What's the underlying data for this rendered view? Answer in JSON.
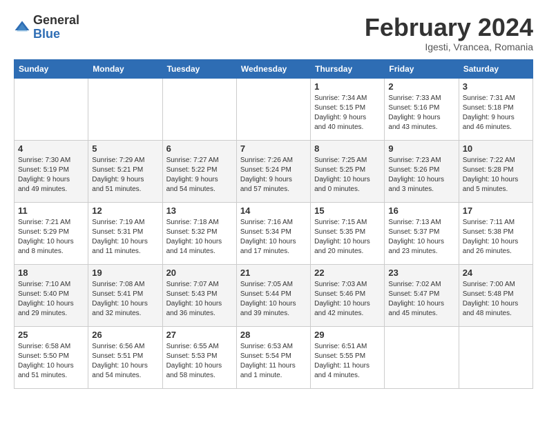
{
  "header": {
    "logo_general": "General",
    "logo_blue": "Blue",
    "title": "February 2024",
    "subtitle": "Igesti, Vrancea, Romania"
  },
  "days_of_week": [
    "Sunday",
    "Monday",
    "Tuesday",
    "Wednesday",
    "Thursday",
    "Friday",
    "Saturday"
  ],
  "weeks": [
    [
      {
        "day": "",
        "info": ""
      },
      {
        "day": "",
        "info": ""
      },
      {
        "day": "",
        "info": ""
      },
      {
        "day": "",
        "info": ""
      },
      {
        "day": "1",
        "info": "Sunrise: 7:34 AM\nSunset: 5:15 PM\nDaylight: 9 hours\nand 40 minutes."
      },
      {
        "day": "2",
        "info": "Sunrise: 7:33 AM\nSunset: 5:16 PM\nDaylight: 9 hours\nand 43 minutes."
      },
      {
        "day": "3",
        "info": "Sunrise: 7:31 AM\nSunset: 5:18 PM\nDaylight: 9 hours\nand 46 minutes."
      }
    ],
    [
      {
        "day": "4",
        "info": "Sunrise: 7:30 AM\nSunset: 5:19 PM\nDaylight: 9 hours\nand 49 minutes."
      },
      {
        "day": "5",
        "info": "Sunrise: 7:29 AM\nSunset: 5:21 PM\nDaylight: 9 hours\nand 51 minutes."
      },
      {
        "day": "6",
        "info": "Sunrise: 7:27 AM\nSunset: 5:22 PM\nDaylight: 9 hours\nand 54 minutes."
      },
      {
        "day": "7",
        "info": "Sunrise: 7:26 AM\nSunset: 5:24 PM\nDaylight: 9 hours\nand 57 minutes."
      },
      {
        "day": "8",
        "info": "Sunrise: 7:25 AM\nSunset: 5:25 PM\nDaylight: 10 hours\nand 0 minutes."
      },
      {
        "day": "9",
        "info": "Sunrise: 7:23 AM\nSunset: 5:26 PM\nDaylight: 10 hours\nand 3 minutes."
      },
      {
        "day": "10",
        "info": "Sunrise: 7:22 AM\nSunset: 5:28 PM\nDaylight: 10 hours\nand 5 minutes."
      }
    ],
    [
      {
        "day": "11",
        "info": "Sunrise: 7:21 AM\nSunset: 5:29 PM\nDaylight: 10 hours\nand 8 minutes."
      },
      {
        "day": "12",
        "info": "Sunrise: 7:19 AM\nSunset: 5:31 PM\nDaylight: 10 hours\nand 11 minutes."
      },
      {
        "day": "13",
        "info": "Sunrise: 7:18 AM\nSunset: 5:32 PM\nDaylight: 10 hours\nand 14 minutes."
      },
      {
        "day": "14",
        "info": "Sunrise: 7:16 AM\nSunset: 5:34 PM\nDaylight: 10 hours\nand 17 minutes."
      },
      {
        "day": "15",
        "info": "Sunrise: 7:15 AM\nSunset: 5:35 PM\nDaylight: 10 hours\nand 20 minutes."
      },
      {
        "day": "16",
        "info": "Sunrise: 7:13 AM\nSunset: 5:37 PM\nDaylight: 10 hours\nand 23 minutes."
      },
      {
        "day": "17",
        "info": "Sunrise: 7:11 AM\nSunset: 5:38 PM\nDaylight: 10 hours\nand 26 minutes."
      }
    ],
    [
      {
        "day": "18",
        "info": "Sunrise: 7:10 AM\nSunset: 5:40 PM\nDaylight: 10 hours\nand 29 minutes."
      },
      {
        "day": "19",
        "info": "Sunrise: 7:08 AM\nSunset: 5:41 PM\nDaylight: 10 hours\nand 32 minutes."
      },
      {
        "day": "20",
        "info": "Sunrise: 7:07 AM\nSunset: 5:43 PM\nDaylight: 10 hours\nand 36 minutes."
      },
      {
        "day": "21",
        "info": "Sunrise: 7:05 AM\nSunset: 5:44 PM\nDaylight: 10 hours\nand 39 minutes."
      },
      {
        "day": "22",
        "info": "Sunrise: 7:03 AM\nSunset: 5:46 PM\nDaylight: 10 hours\nand 42 minutes."
      },
      {
        "day": "23",
        "info": "Sunrise: 7:02 AM\nSunset: 5:47 PM\nDaylight: 10 hours\nand 45 minutes."
      },
      {
        "day": "24",
        "info": "Sunrise: 7:00 AM\nSunset: 5:48 PM\nDaylight: 10 hours\nand 48 minutes."
      }
    ],
    [
      {
        "day": "25",
        "info": "Sunrise: 6:58 AM\nSunset: 5:50 PM\nDaylight: 10 hours\nand 51 minutes."
      },
      {
        "day": "26",
        "info": "Sunrise: 6:56 AM\nSunset: 5:51 PM\nDaylight: 10 hours\nand 54 minutes."
      },
      {
        "day": "27",
        "info": "Sunrise: 6:55 AM\nSunset: 5:53 PM\nDaylight: 10 hours\nand 58 minutes."
      },
      {
        "day": "28",
        "info": "Sunrise: 6:53 AM\nSunset: 5:54 PM\nDaylight: 11 hours\nand 1 minute."
      },
      {
        "day": "29",
        "info": "Sunrise: 6:51 AM\nSunset: 5:55 PM\nDaylight: 11 hours\nand 4 minutes."
      },
      {
        "day": "",
        "info": ""
      },
      {
        "day": "",
        "info": ""
      }
    ]
  ]
}
